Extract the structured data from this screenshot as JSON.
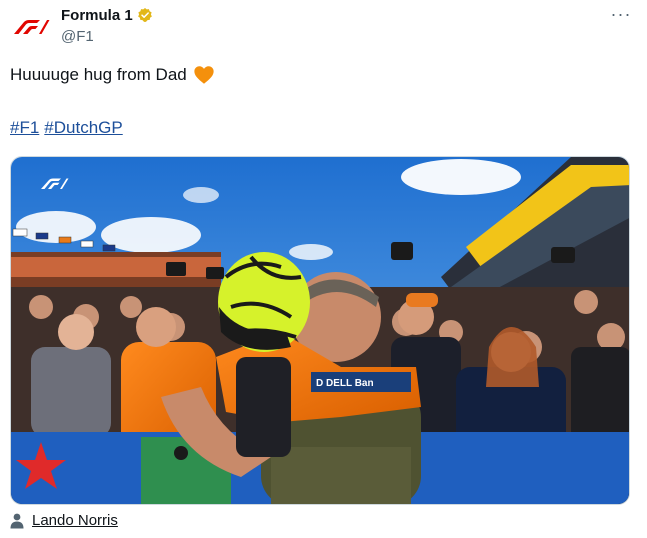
{
  "author": {
    "display_name": "Formula 1",
    "handle": "@F1",
    "verified": true,
    "avatar_icon": "f1-logo-icon",
    "brand_color": "#e10600"
  },
  "menu": {
    "icon": "more-options-icon",
    "label": "···"
  },
  "tweet": {
    "text": "Huuuuge hug from Dad",
    "emoji_icon": "orange-heart-icon",
    "emoji_color": "#f4900c",
    "hashtags": [
      "#F1",
      "#DutchGP"
    ]
  },
  "photo": {
    "watermark_icon": "f1-watermark-icon",
    "description_icon": "embedded-photo"
  },
  "tagged": {
    "icon": "person-icon",
    "name": "Lando Norris"
  }
}
